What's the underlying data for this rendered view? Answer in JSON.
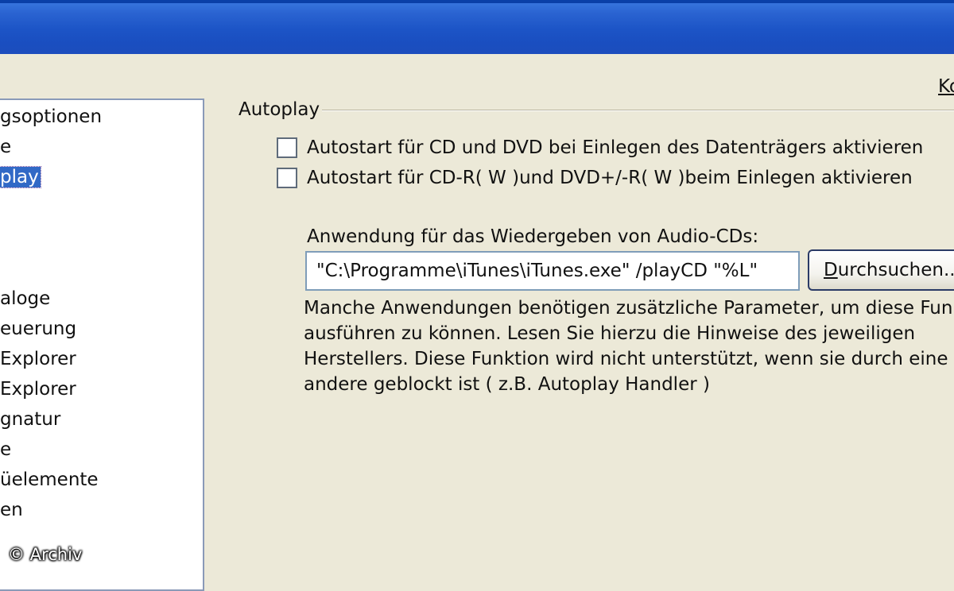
{
  "sidebar": {
    "items": [
      {
        "label": "gsoptionen",
        "selected": false
      },
      {
        "label": "e",
        "selected": false
      },
      {
        "label": "play",
        "selected": true
      },
      {
        "label": "aloge",
        "selected": false
      },
      {
        "label": "euerung",
        "selected": false
      },
      {
        "label": "Explorer",
        "selected": false
      },
      {
        "label": "Explorer",
        "selected": false
      },
      {
        "label": "gnatur",
        "selected": false
      },
      {
        "label": "e",
        "selected": false
      },
      {
        "label": "üelemente",
        "selected": false
      },
      {
        "label": "en",
        "selected": false
      }
    ]
  },
  "main": {
    "corner_link": "Ko",
    "group_title": "Autoplay",
    "checkboxes": [
      {
        "label": "Autostart für CD und DVD bei Einlegen des Datenträgers aktivieren",
        "checked": false
      },
      {
        "label": "Autostart für CD-R( W )und DVD+/-R( W )beim Einlegen aktivieren",
        "checked": false
      }
    ],
    "audio_app_label": "Anwendung für das Wiedergeben von Audio-CDs:",
    "audio_app_value": "\"C:\\Programme\\iTunes\\iTunes.exe\" /playCD \"%L\"",
    "browse_label": "Durchsuchen...",
    "help_lines": [
      "Manche Anwendungen benötigen zusätzliche Parameter, um diese Funkt",
      "ausführen zu können. Lesen Sie hierzu die Hinweise des jeweiligen",
      "Herstellers. Diese Funktion wird nicht unterstützt, wenn sie durch eine",
      "andere geblockt ist ( z.B. Autoplay Handler )"
    ]
  },
  "watermark": "© Archiv",
  "colors": {
    "titlebar": "#1c54c6",
    "window_bg": "#ece9d8",
    "selection": "#3169c6"
  }
}
